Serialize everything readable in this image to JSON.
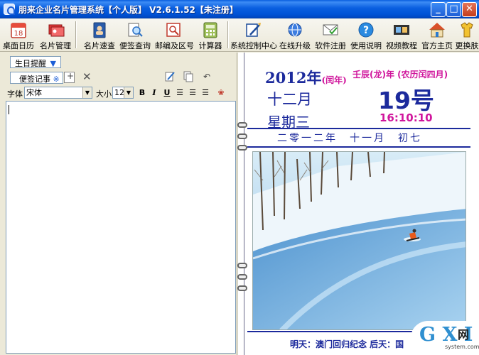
{
  "window": {
    "title": "朋来企业名片管理系统【个人版】 V2.6.1.52【未注册】",
    "min_icon": "minimize-icon",
    "max_icon": "maximize-icon",
    "close_icon": "close-icon"
  },
  "toolbar": {
    "items": [
      {
        "label": "桌面日历",
        "icon": "calendar-icon"
      },
      {
        "label": "名片管理",
        "icon": "cards-icon"
      },
      {
        "label": "名片速查",
        "icon": "contact-book-icon"
      },
      {
        "label": "便签查询",
        "icon": "note-search-icon"
      },
      {
        "label": "邮编及区号",
        "icon": "postcode-icon"
      },
      {
        "label": "计算器",
        "icon": "calculator-icon"
      },
      {
        "label": "系统控制中心",
        "icon": "control-center-icon"
      },
      {
        "label": "在线升级",
        "icon": "online-upgrade-icon"
      },
      {
        "label": "软件注册",
        "icon": "register-icon"
      },
      {
        "label": "使用说明",
        "icon": "help-icon"
      },
      {
        "label": "视频教程",
        "icon": "video-icon"
      },
      {
        "label": "官方主页",
        "icon": "home-icon"
      },
      {
        "label": "更换肤",
        "icon": "skin-icon"
      }
    ]
  },
  "left": {
    "tab_label": "生日提醒",
    "tab_arrow": "▼",
    "subtab_label": "便签记事",
    "subtab_dot": "※",
    "font_label": "字体",
    "font_value": "宋体",
    "size_label": "大小",
    "size_value": "12",
    "bold": "B",
    "italic": "I",
    "underline": "U"
  },
  "calendar": {
    "year": "2012年",
    "leap_note": "(闰年)",
    "ganzhi": "壬辰(龙)年 (农历闰四月)",
    "month": "十二月",
    "day": "19号",
    "weekday": "星期三",
    "time": "16:10:10",
    "lunar_date": "二零一二年　十一月　初七",
    "footer": "明天：澳门回归纪念 后天：国"
  },
  "watermark": {
    "main": "G X I",
    "net": "网",
    "sub": "system.com"
  },
  "colors": {
    "calendar_blue": "#1c2a9c",
    "calendar_magenta": "#d0159c",
    "title_blue": "#0a5fe0"
  }
}
